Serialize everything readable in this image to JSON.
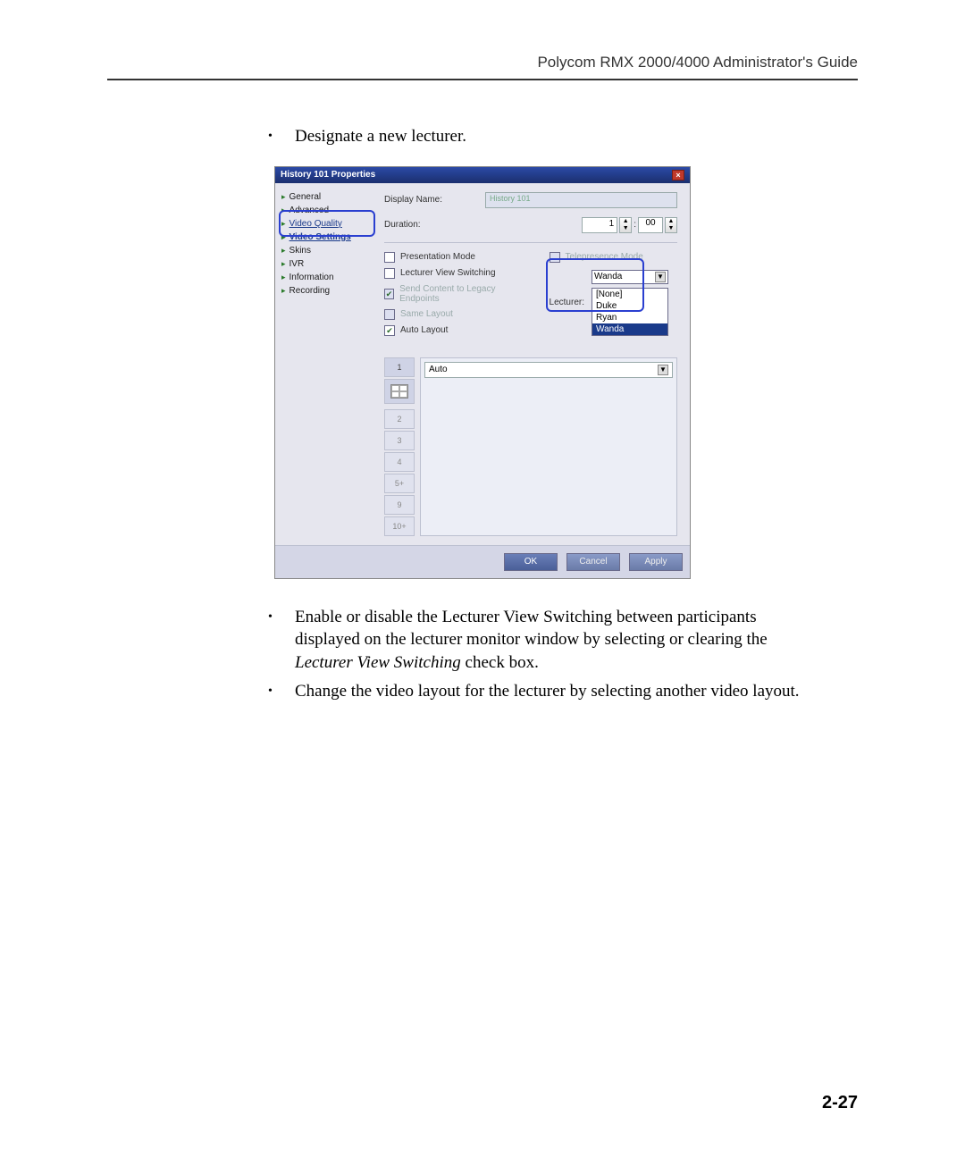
{
  "header": "Polycom RMX 2000/4000 Administrator's Guide",
  "page_number": "2-27",
  "bullets": {
    "b1": "Designate a new lecturer.",
    "b2_pre": "Enable or disable the Lecturer View Switching between participants displayed on the lecturer monitor window by selecting or clearing the ",
    "b2_italic": "Lecturer View Switching",
    "b2_post": " check box.",
    "b3": "Change the video layout for the lecturer by selecting another video layout."
  },
  "dialog": {
    "title": "History 101 Properties",
    "nav": {
      "items": [
        "General",
        "Advanced",
        "Video Quality",
        "Video Settings",
        "Skins",
        "IVR",
        "Information",
        "Recording"
      ]
    },
    "fields": {
      "display_name_label": "Display Name:",
      "display_name_value": "History 101",
      "duration_label": "Duration:",
      "duration_hours": "1",
      "duration_minutes": "00"
    },
    "checks": {
      "presentation_mode": "Presentation Mode",
      "telepresence_mode": "Telepresence Mode",
      "lecturer_view_switching": "Lecturer View Switching",
      "send_content": "Send Content to Legacy Endpoints",
      "same_layout": "Same Layout",
      "auto_layout": "Auto Layout"
    },
    "lecturer": {
      "label": "Lecturer:",
      "selected": "Wanda",
      "options": [
        "[None]",
        "Duke",
        "Ryan",
        "Wanda"
      ]
    },
    "layout": {
      "auto_option": "Auto",
      "tabs": [
        "1",
        "2",
        "3",
        "4",
        "5+",
        "9",
        "10+"
      ]
    },
    "buttons": {
      "ok": "OK",
      "cancel": "Cancel",
      "apply": "Apply"
    }
  }
}
